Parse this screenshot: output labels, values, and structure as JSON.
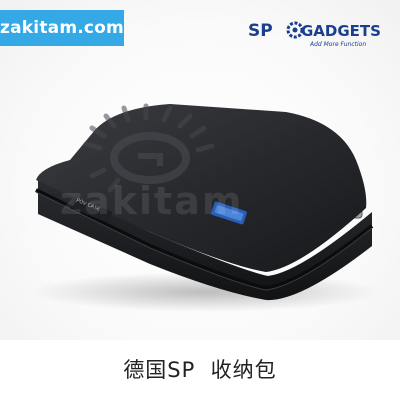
{
  "watermark": {
    "text": "zakitam.com",
    "color": "#35a8e6"
  },
  "brand": {
    "name_left": "SP",
    "name_right": "GADGETS",
    "tagline": "Add More Function",
    "color": "#1b3f8f"
  },
  "product": {
    "icon": "camera-case-photo",
    "case_label": "POV CASE",
    "overlay_watermark": "zakitam"
  },
  "caption": {
    "text": "德国SP  收纳包"
  }
}
